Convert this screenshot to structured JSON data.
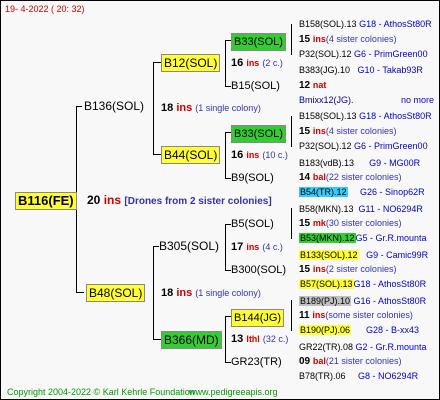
{
  "header": "19-   4-2022 (  20: 32)",
  "footer": {
    "copyright": "Copyright 2004-2022 © Karl Kehrle Foundation",
    "site": "www.pedigreeapis.org"
  },
  "root": {
    "name": "B116(FE)",
    "num": "20",
    "ins": "ins",
    "note": "[Drones from 2 sister colonies]"
  },
  "b136": {
    "name": "B136(SOL)",
    "num": "18",
    "ins": "ins",
    "note": "(1 single colony)"
  },
  "b12": {
    "name": "B12(SOL)",
    "num": "16",
    "ins": "ins",
    "note": "(2 c.)"
  },
  "b33a": {
    "name": "B33(SOL)"
  },
  "b15": {
    "name": "B15(SOL)"
  },
  "b44": {
    "name": "B44(SOL)",
    "num": "16",
    "ins": "ins",
    "note": "(10 c.)"
  },
  "b33b": {
    "name": "B33(SOL)"
  },
  "b9": {
    "name": "B9(SOL)"
  },
  "b48": {
    "name": "B48(SOL)",
    "num": "18",
    "ins": "ins",
    "note": "(1 single colony)"
  },
  "b305": {
    "name": "B305(SOL)",
    "num": "17",
    "ins": "ins",
    "note": "(4 c.)"
  },
  "b5": {
    "name": "B5(SOL)"
  },
  "b300": {
    "name": "B300(SOL)"
  },
  "b366": {
    "name": "B366(MD)",
    "num": "13",
    "ins": "lthl",
    "note": "(32 c.)"
  },
  "b144": {
    "name": "B144(JG)"
  },
  "gr23": {
    "name": "GR23(TR)"
  },
  "leaves": {
    "l1": {
      "a": "B158(SOL).13",
      "b": "G18 - AthosSt80R"
    },
    "l2": {
      "num": "15",
      "ins": "ins",
      "note": "(4 sister colonies)"
    },
    "l3": {
      "a": "P32(SOL).12",
      "b": "G6 - PrimGreen00"
    },
    "l4": {
      "a": "B383(JG).10",
      "b": "G10 - Takab93R"
    },
    "l5": {
      "num": "12",
      "ins": "nat"
    },
    "l6": {
      "a": "Bmixx12(JG).",
      "b": "no more"
    },
    "l7": {
      "a": "B158(SOL).13",
      "b": "G18 - AthosSt80R"
    },
    "l8": {
      "num": "15",
      "ins": "ins",
      "note": "(4 sister colonies)"
    },
    "l9": {
      "a": "P32(SOL).12",
      "b": "G6 - PrimGreen00"
    },
    "l10": {
      "a": "B183(vdB).13",
      "b": "G9 - MG00R"
    },
    "l11": {
      "num": "14",
      "ins": "bal",
      "note": "(22 sister colonies)"
    },
    "l12": {
      "a": "B54(TR).12",
      "b": "G26 - Sinop62R"
    },
    "l13": {
      "a": "B58(MKN).13",
      "b": "G11 - NO6294R"
    },
    "l14": {
      "num": "15",
      "ins": "mk",
      "note": "(30 sister colonies)"
    },
    "l15": {
      "a": "B53(MKN).12",
      "b": "G5 - Gr.R.mounta"
    },
    "l16": {
      "a": "B133(SOL).12",
      "b": "G9 - Camic99R"
    },
    "l17": {
      "num": "15",
      "ins": "ins",
      "note": "(2 sister colonies)"
    },
    "l18": {
      "a": "B57(SOL).13",
      "b": "G18 - AthosSt80R"
    },
    "l19": {
      "a": "B189(PJ).10",
      "b": "G16 - AthosSt80R"
    },
    "l20": {
      "num": "11",
      "ins": "ins",
      "note": "(some sister colonies)"
    },
    "l21": {
      "a": "B190(PJ).06",
      "b": "G28 - B-xx43"
    },
    "l22": {
      "a": "GR22(TR).08",
      "b": "G2 - Gr.R.mounta"
    },
    "l23": {
      "num": "09",
      "ins": "bal",
      "note": "(21 sister colonies)"
    },
    "l24": {
      "a": "B78(TR).06",
      "b": "G8 - NO6294R"
    }
  }
}
